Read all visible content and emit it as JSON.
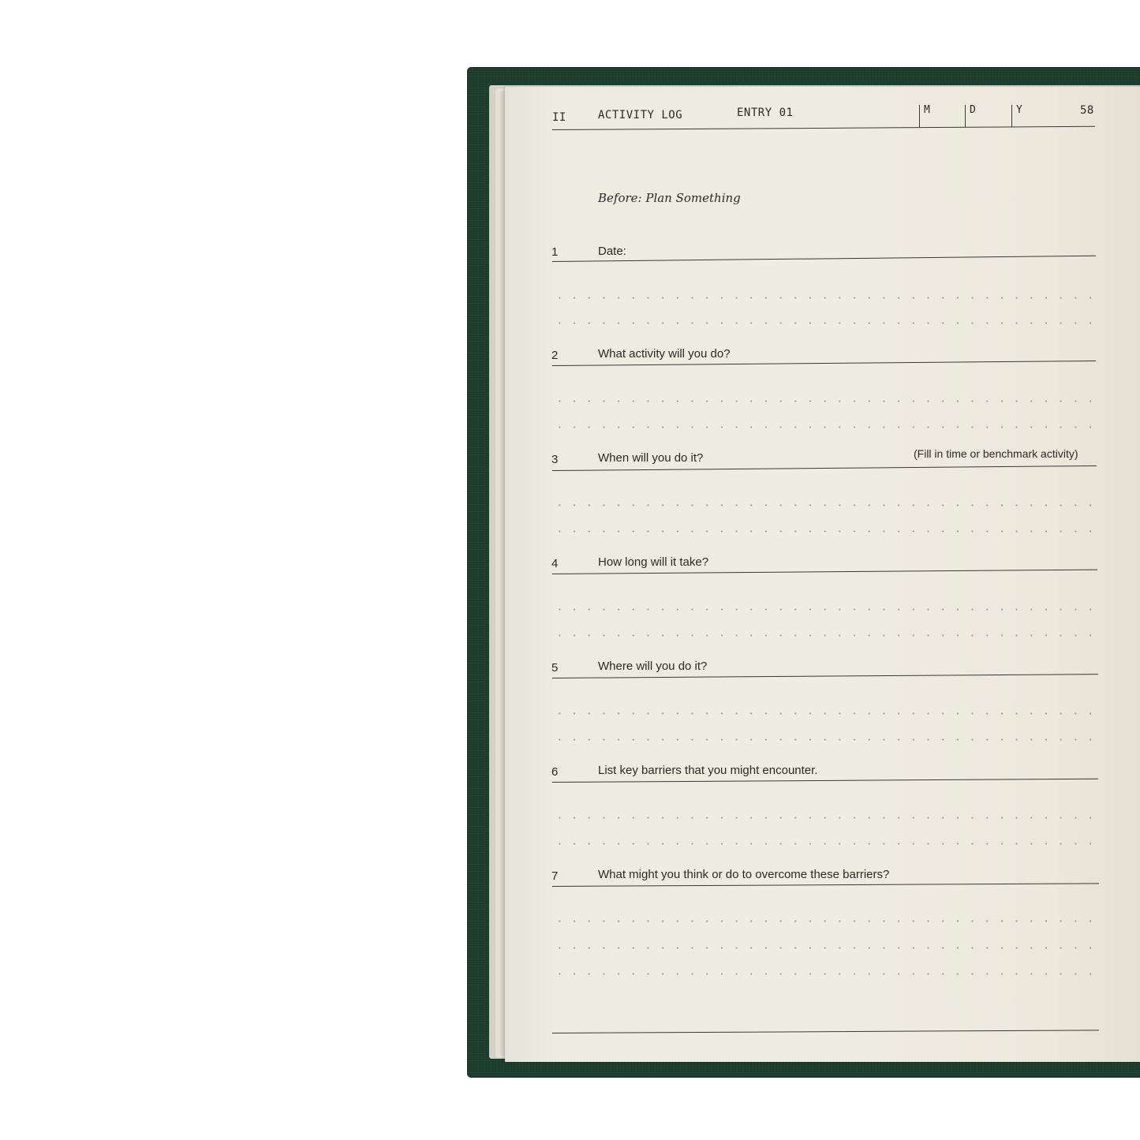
{
  "header": {
    "section": "II",
    "title": "ACTIVITY LOG",
    "entry": "ENTRY 01",
    "month_label": "M",
    "day_label": "D",
    "year_label": "Y",
    "page_number": "58"
  },
  "heading": "Before: Plan Something",
  "questions": [
    {
      "num": "1",
      "text": "Date:"
    },
    {
      "num": "2",
      "text": "What activity will you do?"
    },
    {
      "num": "3",
      "text": "When will you do it?",
      "note": "(Fill in time or benchmark activity)"
    },
    {
      "num": "4",
      "text": "How long will it take?"
    },
    {
      "num": "5",
      "text": "Where will you do it?"
    },
    {
      "num": "6",
      "text": "List key barriers that you might encounter."
    },
    {
      "num": "7",
      "text": "What might you think or do to overcome these barriers?"
    }
  ],
  "colors": {
    "cover": "#1b3d2c",
    "paper": "#eeebe0",
    "ink": "#2b2a27"
  }
}
